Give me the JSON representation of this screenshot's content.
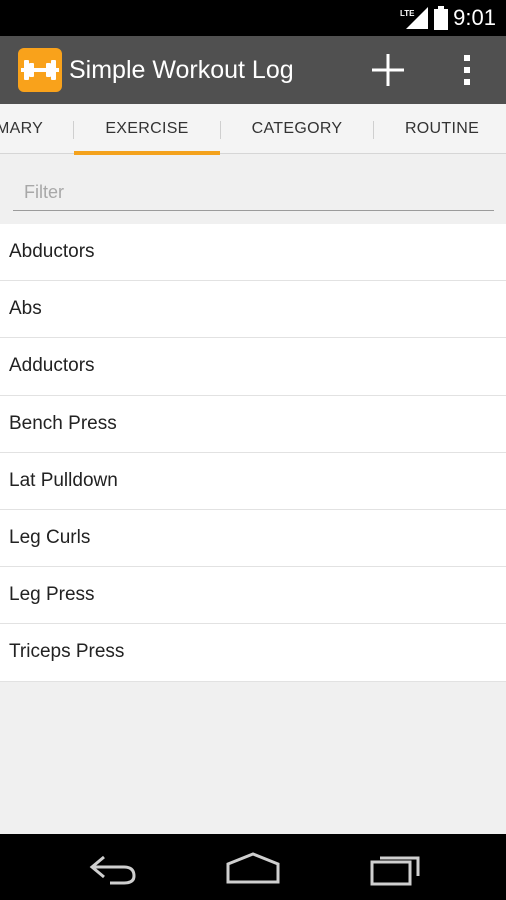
{
  "status_bar": {
    "time": "9:01",
    "network_label": "LTE",
    "icons": [
      "lte-signal-icon",
      "battery-icon"
    ]
  },
  "action_bar": {
    "title": "Simple Workout Log",
    "app_icon": "dumbbell-icon",
    "actions": [
      "add-icon",
      "overflow-menu-icon"
    ],
    "background_color": "#505050",
    "accent_color": "#f9a21b"
  },
  "tabs": [
    {
      "label": "MARY",
      "selected": false
    },
    {
      "label": "EXERCISE",
      "selected": true
    },
    {
      "label": "CATEGORY",
      "selected": false
    },
    {
      "label": "ROUTINE",
      "selected": false
    }
  ],
  "filter": {
    "placeholder": "Filter",
    "value": ""
  },
  "exercises": [
    "Abductors",
    "Abs",
    "Adductors",
    "Bench Press",
    "Lat Pulldown",
    "Leg Curls",
    "Leg Press",
    "Triceps Press"
  ],
  "navigation_bar": {
    "buttons": [
      "back-icon",
      "home-icon",
      "recent-apps-icon"
    ]
  }
}
